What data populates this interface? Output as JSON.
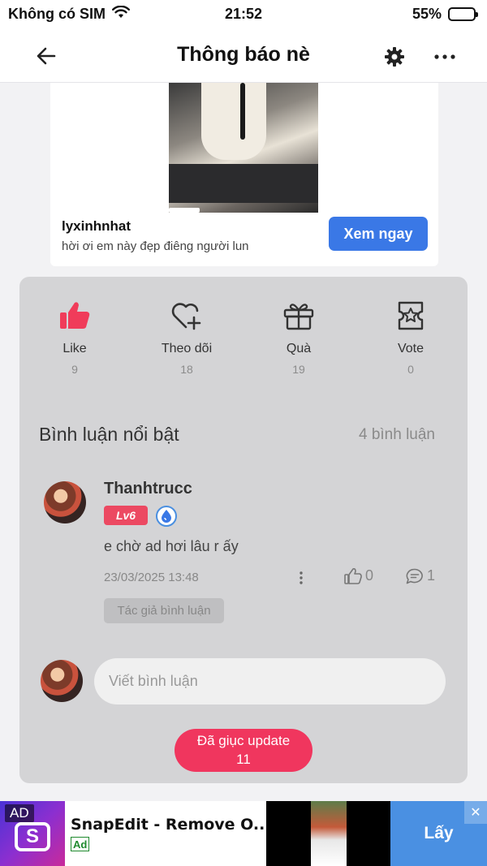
{
  "status_bar": {
    "carrier": "Không có SIM",
    "time": "21:52",
    "battery_text": "55%",
    "battery_level": 0.55
  },
  "nav": {
    "title": "Thông báo nè"
  },
  "post": {
    "author": "lyxinhnhat",
    "caption": "hời ơi em này đẹp điêng người lun",
    "cta_label": "Xem ngay"
  },
  "actions": [
    {
      "label": "Like",
      "count": "9",
      "icon": "thumbs-up-icon"
    },
    {
      "label": "Theo dõi",
      "count": "18",
      "icon": "heart-plus-icon"
    },
    {
      "label": "Quà",
      "count": "19",
      "icon": "gift-icon"
    },
    {
      "label": "Vote",
      "count": "0",
      "icon": "vote-ticket-icon"
    }
  ],
  "comments_section": {
    "title": "Bình luận nổi bật",
    "count_label": "4 bình luận"
  },
  "comment": {
    "author": "Thanhtrucc",
    "level": "Lv6",
    "text": "e chờ ad hơi lâu r ấy",
    "timestamp": "23/03/2025 13:48",
    "likes": "0",
    "replies": "1",
    "tag": "Tác giả bình luận"
  },
  "comment_input": {
    "placeholder": "Viết bình luận"
  },
  "update_button": {
    "label": "Đã giục update",
    "count": "11"
  },
  "ad": {
    "mark": "AD",
    "title": "SnapEdit - Remove O...",
    "label": "Ad",
    "get_label": "Lấy",
    "close": "✕"
  },
  "colors": {
    "accent_blue": "#3a78e6",
    "like_red": "#f03c5a",
    "update_pink": "#f0365e",
    "panel_gray": "#d4d4d6"
  }
}
